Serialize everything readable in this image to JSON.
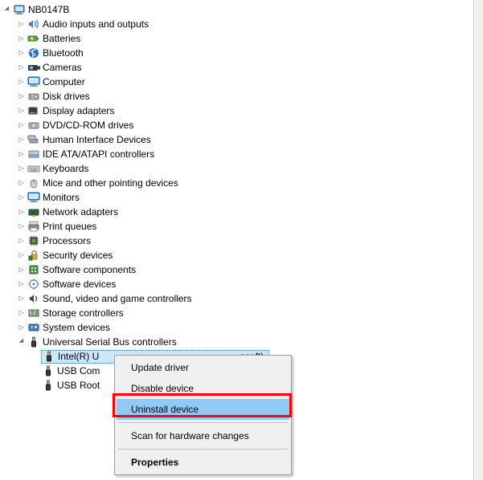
{
  "root": {
    "label": "NB0147B"
  },
  "categories": [
    {
      "icon": "audio",
      "label": "Audio inputs and outputs"
    },
    {
      "icon": "battery",
      "label": "Batteries"
    },
    {
      "icon": "bluetooth",
      "label": "Bluetooth"
    },
    {
      "icon": "camera",
      "label": "Cameras"
    },
    {
      "icon": "computer",
      "label": "Computer"
    },
    {
      "icon": "disk",
      "label": "Disk drives"
    },
    {
      "icon": "display",
      "label": "Display adapters"
    },
    {
      "icon": "dvd",
      "label": "DVD/CD-ROM drives"
    },
    {
      "icon": "hid",
      "label": "Human Interface Devices"
    },
    {
      "icon": "ide",
      "label": "IDE ATA/ATAPI controllers"
    },
    {
      "icon": "keyboard",
      "label": "Keyboards"
    },
    {
      "icon": "mouse",
      "label": "Mice and other pointing devices"
    },
    {
      "icon": "monitor",
      "label": "Monitors"
    },
    {
      "icon": "network",
      "label": "Network adapters"
    },
    {
      "icon": "printer",
      "label": "Print queues"
    },
    {
      "icon": "processor",
      "label": "Processors"
    },
    {
      "icon": "security",
      "label": "Security devices"
    },
    {
      "icon": "software",
      "label": "Software components"
    },
    {
      "icon": "softdev",
      "label": "Software devices"
    },
    {
      "icon": "sound",
      "label": "Sound, video and game controllers"
    },
    {
      "icon": "storage",
      "label": "Storage controllers"
    },
    {
      "icon": "system",
      "label": "System devices"
    }
  ],
  "usb": {
    "label": "Universal Serial Bus controllers",
    "children": [
      {
        "label_full": "Intel(R) U",
        "label_tail": "osoft)",
        "selected": true
      },
      {
        "label_full": "USB Com"
      },
      {
        "label_full": "USB Root"
      }
    ]
  },
  "context_menu": {
    "items": [
      {
        "label": "Update driver"
      },
      {
        "label": "Disable device"
      },
      {
        "label": "Uninstall device",
        "highlighted": true
      },
      {
        "sep": true
      },
      {
        "label": "Scan for hardware changes"
      },
      {
        "sep": true
      },
      {
        "label": "Properties",
        "bold": true
      }
    ]
  }
}
